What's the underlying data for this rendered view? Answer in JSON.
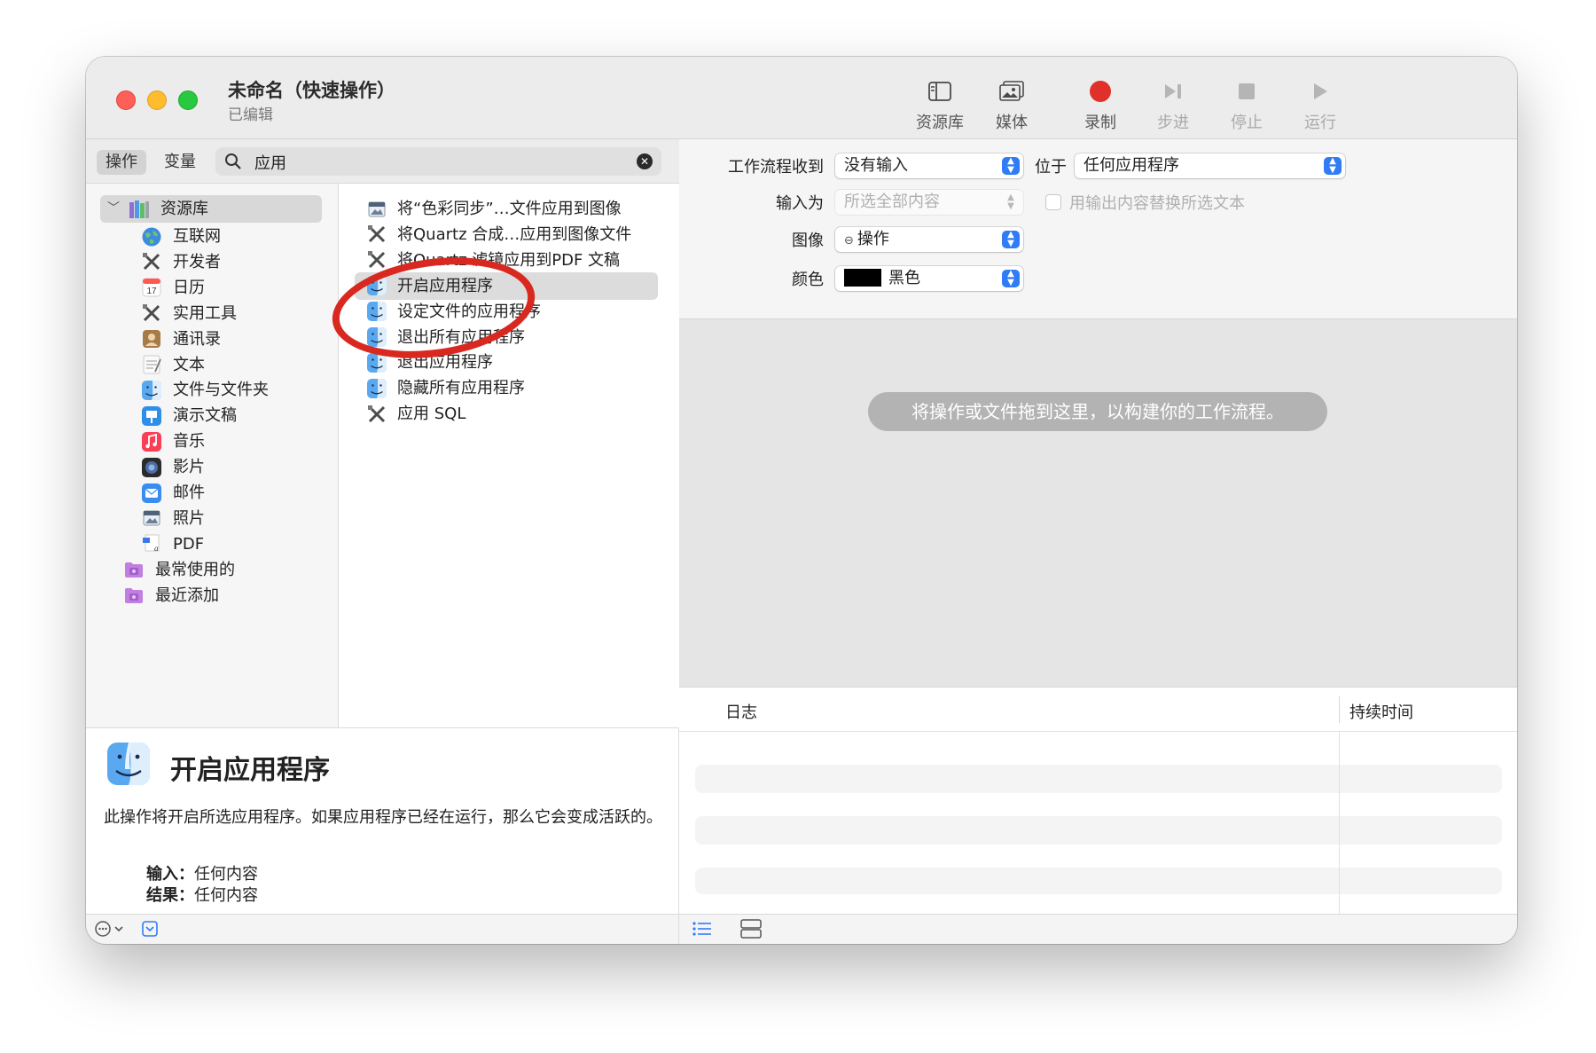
{
  "window": {
    "title": "未命名（快速操作）",
    "subtitle": "已编辑"
  },
  "toolbar": {
    "library_label": "资源库",
    "media_label": "媒体",
    "record_label": "录制",
    "step_label": "步进",
    "stop_label": "停止",
    "run_label": "运行"
  },
  "left_panel": {
    "tab_actions": "操作",
    "tab_variables": "变量",
    "search_value": "应用"
  },
  "library": {
    "root_label": "资源库",
    "items": [
      {
        "label": "互联网",
        "icon": "globe-icon"
      },
      {
        "label": "开发者",
        "icon": "tools-icon"
      },
      {
        "label": "日历",
        "icon": "calendar-icon"
      },
      {
        "label": "实用工具",
        "icon": "tools-icon"
      },
      {
        "label": "通讯录",
        "icon": "contacts-icon"
      },
      {
        "label": "文本",
        "icon": "text-icon"
      },
      {
        "label": "文件与文件夹",
        "icon": "finder-icon"
      },
      {
        "label": "演示文稿",
        "icon": "keynote-icon"
      },
      {
        "label": "音乐",
        "icon": "music-icon"
      },
      {
        "label": "影片",
        "icon": "movie-icon"
      },
      {
        "label": "邮件",
        "icon": "mail-icon"
      },
      {
        "label": "照片",
        "icon": "photos-icon"
      },
      {
        "label": "PDF",
        "icon": "pdf-icon"
      }
    ],
    "smart_groups": [
      {
        "label": "最常使用的",
        "icon": "folder-icon"
      },
      {
        "label": "最近添加",
        "icon": "folder-icon"
      }
    ]
  },
  "actions": {
    "items": [
      {
        "label": "将“色彩同步”…文件应用到图像",
        "icon": "image-app-icon"
      },
      {
        "label": "将Quartz 合成…应用到图像文件",
        "icon": "tools-icon"
      },
      {
        "label": "将Quartz 滤镜应用到PDF 文稿",
        "icon": "tools-icon"
      },
      {
        "label": "开启应用程序",
        "icon": "finder-icon"
      },
      {
        "label": "设定文件的应用程序",
        "icon": "finder-icon"
      },
      {
        "label": "退出所有应用程序",
        "icon": "finder-icon"
      },
      {
        "label": "退出应用程序",
        "icon": "finder-icon"
      },
      {
        "label": "隐藏所有应用程序",
        "icon": "finder-icon"
      },
      {
        "label": "应用 SQL",
        "icon": "tools-icon"
      }
    ],
    "selected_index": 3
  },
  "description": {
    "title": "开启应用程序",
    "text": "此操作将开启所选应用程序。如果应用程序已经在运行，那么它会变成活跃的。",
    "input_label": "输入：",
    "input_value": "任何内容",
    "result_label": "结果：",
    "result_value": "任何内容"
  },
  "workflow": {
    "receives_label": "工作流程收到",
    "receives_value": "没有输入",
    "in_label": "位于",
    "in_value": "任何应用程序",
    "input_is_label": "输入为",
    "input_is_value": "所选全部内容",
    "replace_label": "用输出内容替换所选文本",
    "image_label": "图像",
    "image_value": "操作",
    "color_label": "颜色",
    "color_value": "黑色",
    "color_swatch": "#000000"
  },
  "canvas": {
    "hint": "将操作或文件拖到这里，以构建你的工作流程。"
  },
  "log": {
    "col_log": "日志",
    "col_duration": "持续时间"
  },
  "colors": {
    "accent": "#2f7cf6",
    "record": "#e0302a",
    "annotation": "#d9281f"
  }
}
